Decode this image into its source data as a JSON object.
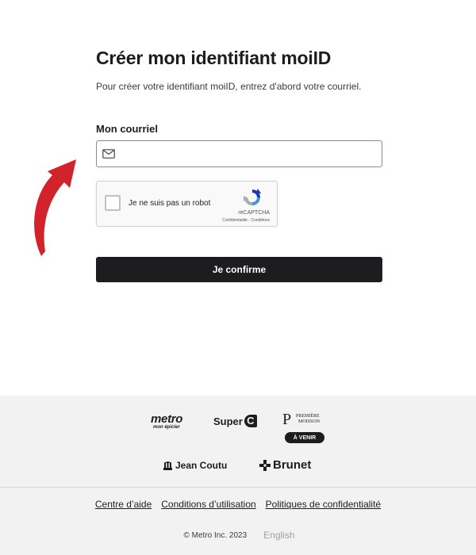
{
  "form": {
    "title": "Créer mon identifiant moiID",
    "subtitle": "Pour créer votre identifiant moiID, entrez d'abord votre courriel.",
    "email_label": "Mon courriel",
    "email_value": "",
    "email_placeholder": "",
    "email_icon": "envelope-icon",
    "confirm_label": "Je confirme"
  },
  "captcha": {
    "label": "Je ne suis pas un robot",
    "brand": "reCAPTCHA",
    "links": "Confidentialité - Conditions",
    "icon": "recaptcha-logo-icon"
  },
  "annotation": {
    "icon": "red-arrow-icon",
    "color": "#d2232a"
  },
  "footer": {
    "brands": {
      "metro_name": "metro",
      "metro_tagline": "mon épicier",
      "superc_text": "Super",
      "superc_letter": "C",
      "pm_letter": "P",
      "pm_line1": "PREMIÈRE",
      "pm_line2": "MOISSON",
      "coming_soon": "À VENIR",
      "jeancoutu": "Jean Coutu",
      "brunet": "Brunet"
    },
    "links": {
      "help": "Centre d’aide",
      "terms": "Conditions d’utilisation",
      "privacy": "Politiques de confidentialité"
    },
    "copyright": "© Metro Inc. 2023",
    "language": "English"
  },
  "colors": {
    "primary_button": "#1d1d1f",
    "footer_bg": "#f2f2f2",
    "input_border": "#8c8c8c"
  }
}
